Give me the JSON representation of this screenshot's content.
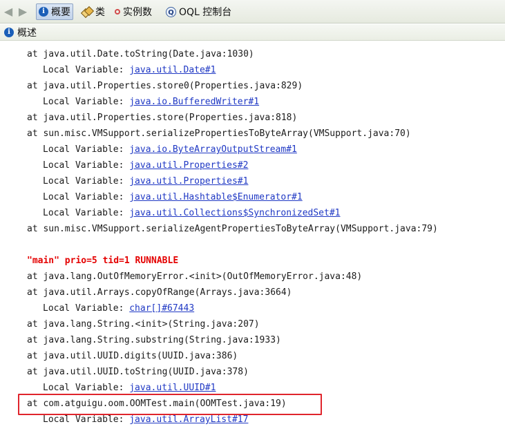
{
  "toolbar": {
    "tabs": [
      {
        "label": "概要",
        "icon": "info-icon",
        "active": true
      },
      {
        "label": "类",
        "icon": "class-icon",
        "active": false
      },
      {
        "label": "实例数",
        "icon": "instance-icon",
        "active": false
      },
      {
        "label": "OQL 控制台",
        "icon": "oql-icon",
        "active": false
      }
    ]
  },
  "subheader": {
    "title": "概述"
  },
  "stack": {
    "lines": [
      "at java.util.Date.toString(Date.java:1030)",
      "at java.util.Properties.store0(Properties.java:829)",
      "at java.util.Properties.store(Properties.java:818)",
      "at sun.misc.VMSupport.serializePropertiesToByteArray(VMSupport.java:70)",
      "at sun.misc.VMSupport.serializeAgentPropertiesToByteArray(VMSupport.java:79)",
      "at java.lang.OutOfMemoryError.<init>(OutOfMemoryError.java:48)",
      "at java.util.Arrays.copyOfRange(Arrays.java:3664)",
      "at java.lang.String.<init>(String.java:207)",
      "at java.lang.String.substring(String.java:1933)",
      "at java.util.UUID.digits(UUID.java:386)",
      "at java.util.UUID.toString(UUID.java:378)",
      "at com.atguigu.oom.OOMTest.main(OOMTest.java:19)"
    ],
    "local_label": "Local Variable:",
    "links": [
      "java.util.Date#1",
      "java.io.BufferedWriter#1",
      "java.io.ByteArrayOutputStream#1",
      "java.util.Properties#2",
      "java.util.Properties#1",
      "java.util.Hashtable$Enumerator#1",
      "java.util.Collections$SynchronizedSet#1",
      "char[]#67443",
      "java.util.UUID#1",
      "java.util.ArrayList#17"
    ],
    "thread_header": "\"main\" prio=5 tid=1 RUNNABLE"
  },
  "colors": {
    "link": "#1f38c4",
    "thread": "#e40000",
    "highlight": "#e0242c"
  }
}
